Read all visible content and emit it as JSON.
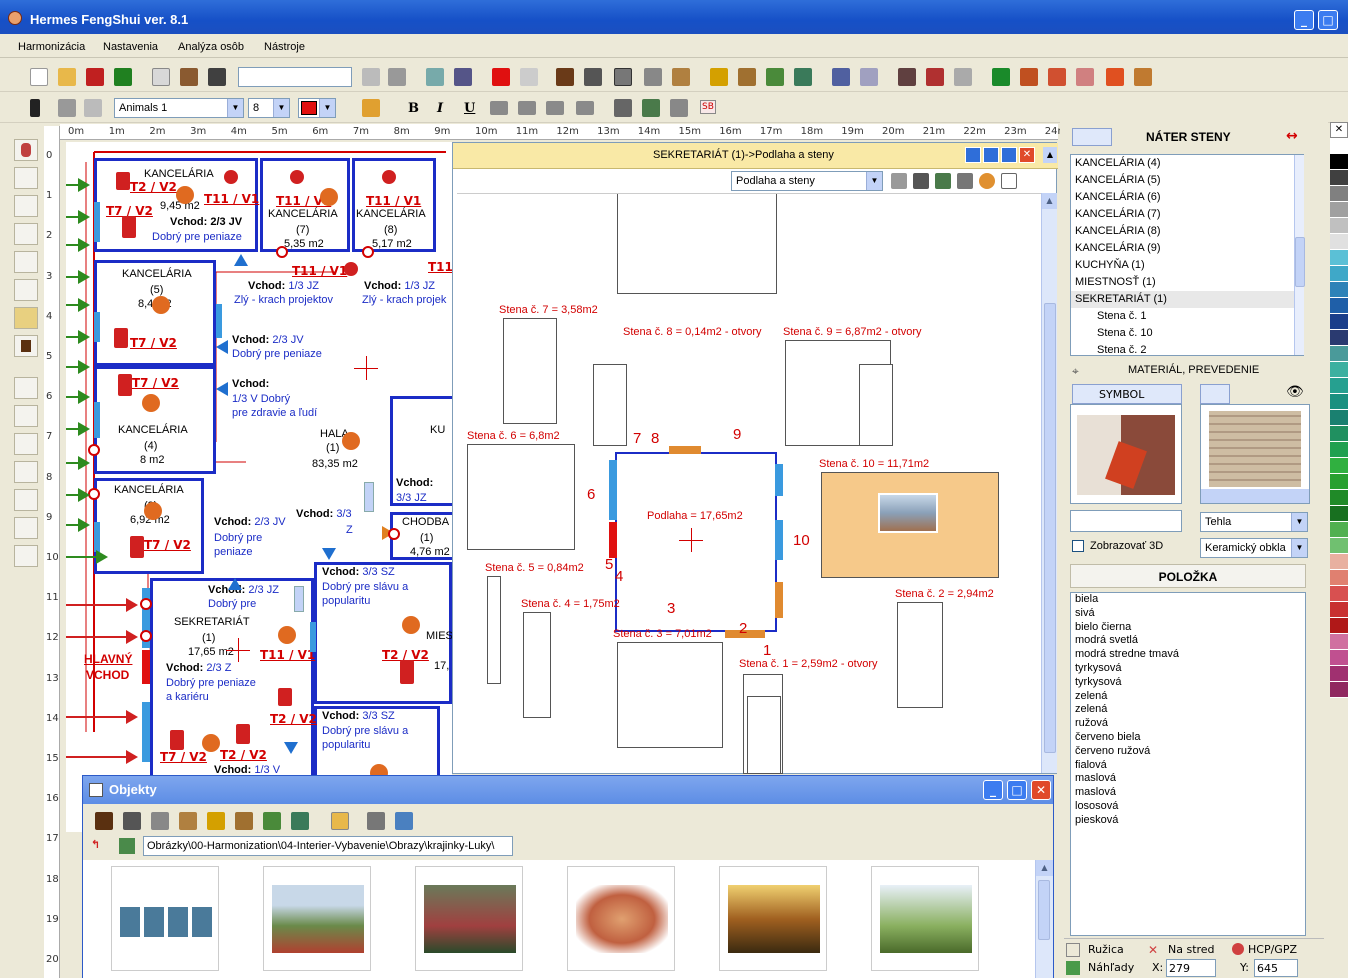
{
  "window": {
    "title": "Hermes FengShui ver. 8.1"
  },
  "menu": [
    "Harmonizácia",
    "Nastavenia",
    "Analýza osôb",
    "Nástroje"
  ],
  "toolbar2": {
    "font": "Animals 1",
    "size": "8",
    "bold": "B",
    "italic": "I",
    "underline": "U",
    "sb": "SB"
  },
  "ruler_h": [
    "0m",
    "1m",
    "2m",
    "3m",
    "4m",
    "5m",
    "6m",
    "7m",
    "8m",
    "9m",
    "10m",
    "11m",
    "12m",
    "13m",
    "14m",
    "15m",
    "16m",
    "17m",
    "18m",
    "19m",
    "20m",
    "21m",
    "22m",
    "23m",
    "24m"
  ],
  "ruler_v": [
    "0",
    "1",
    "2",
    "3",
    "4",
    "5",
    "6",
    "7",
    "8",
    "9",
    "10",
    "11",
    "12",
    "13",
    "14",
    "15",
    "16",
    "17",
    "18",
    "19",
    "20"
  ],
  "plan": {
    "rooms": [
      {
        "name": "KANCELÁRIA",
        "line2": "9,45 m2",
        "vchod": "Vchod: 2/3 JV",
        "note": "Dobrý pre peniaze"
      },
      {
        "name": "KANCELÁRIA",
        "line2": "(7)",
        "line3": "5,35 m2"
      },
      {
        "name": "KANCELÁRIA",
        "line2": "(8)",
        "line3": "5,17 m2"
      },
      {
        "name": "KANCELÁRIA",
        "line2": "(5)",
        "line3": "8,4 m2"
      },
      {
        "name": "KANCELÁRIA",
        "line2": "(4)",
        "line3": "8 m2"
      },
      {
        "name": "KANCELÁRIA",
        "line2": "(3)",
        "line3": "6,92 m2"
      },
      {
        "name": "SEKRETARIÁT",
        "line2": "(1)",
        "line3": "17,65 m2"
      },
      {
        "name": "HALA",
        "line2": "(1)",
        "line3": "83,35 m2"
      },
      {
        "name": "KU"
      },
      {
        "name": "CHODBA",
        "line2": "(1)",
        "line3": "4,76 m2"
      },
      {
        "name": "MIES"
      }
    ],
    "tags": [
      "T2 / V2",
      "T11 / V1",
      "T7 / V2",
      "T11 / V1",
      "T11 / V1",
      "T11 / V1",
      "T11",
      "T7 / V2",
      "T7 / V2",
      "T7 / V2",
      "T2 / V2",
      "T11 / V1",
      "T2 / V2",
      "T7 / V2",
      "T2 / V2"
    ],
    "entries": [
      {
        "title": "Vchod:",
        "text": "1/3 JZ",
        "note": "Zlý - krach projektov"
      },
      {
        "title": "Vchod:",
        "text": "1/3 JZ",
        "note": "Zlý - krach projek"
      },
      {
        "title": "Vchod:",
        "text": "2/3 JV",
        "note": "Dobrý pre peniaze"
      },
      {
        "title": "Vchod:",
        "text": "1/3 V Dobrý",
        "note": "pre zdravie a ľudí"
      },
      {
        "title": "Vchod:",
        "text": "3/3 JZ"
      },
      {
        "title": "Vchod:",
        "text": "2/3 JV",
        "note": "Dobrý pre",
        "note2": "peniaze"
      },
      {
        "title": "Vchod:",
        "text": "3/3",
        "note": "Z"
      },
      {
        "title": "Vchod:",
        "text": "2/3 JZ",
        "note": "Dobrý pre"
      },
      {
        "title": "Vchod:",
        "text": "3/3 SZ",
        "note": "Dobrý pre slávu a",
        "note2": "popularitu"
      },
      {
        "title": "Vchod:",
        "text": "2/3 Z",
        "note": "Dobrý pre peniaze",
        "note2": "a kariéru"
      },
      {
        "title": "Vchod:",
        "text": "3/3 SZ",
        "note": "Dobrý pre slávu a",
        "note2": "popularitu"
      },
      {
        "title": "Vchod:",
        "text": "1/3 V"
      }
    ],
    "main_entrance": [
      "HLAVNÝ",
      "VCHOD"
    ],
    "num17": "17,"
  },
  "subwindow": {
    "title": "SEKRETARIÁT (1)->Podlaha a steny",
    "select": "Podlaha a steny",
    "labels": {
      "s7": "Stena č. 7 = 3,58m2",
      "s8": "Stena č. 8 = 0,14m2 - otvory",
      "s9": "Stena č. 9 = 6,87m2 - otvory",
      "s6": "Stena č. 6 = 6,8m2",
      "s10": "Stena č. 10 = 11,71m2",
      "floor": "Podlaha = 17,65m2",
      "s5": "Stena č. 5 = 0,84m2",
      "s4": "Stena č. 4 = 1,75m2",
      "s3": "Stena č. 3 = 7,01m2",
      "s2": "Stena č. 2 = 2,94m2",
      "s1": "Stena č. 1 = 2,59m2 - otvory"
    },
    "nums": {
      "n7": "7",
      "n8": "8",
      "n9": "9",
      "n6": "6",
      "n10": "10",
      "n5": "5",
      "n4": "4",
      "n3": "3",
      "n2": "2",
      "n1": "1"
    }
  },
  "right": {
    "header": "NÁTER STENY",
    "tree": [
      "KANCELÁRIA (4)",
      "KANCELÁRIA (5)",
      "KANCELÁRIA (6)",
      "KANCELÁRIA (7)",
      "KANCELÁRIA (8)",
      "KANCELÁRIA (9)",
      "KUCHYŇA (1)",
      "MIESTNOSŤ (1)",
      "SEKRETARIÁT (1)",
      "Stena č. 1",
      "Stena č. 10",
      "Stena č. 2"
    ],
    "material": "MATERIÁL, PREVEDENIE",
    "symbol": "SYMBOL",
    "select1": "Tehla",
    "checkbox": "Zobrazovať 3D",
    "select2": "Keramický obkla",
    "item_header": "POLOŽKA",
    "items": [
      "biela",
      "sivá",
      "bielo čierna",
      "modrá svetlá",
      "modrá stredne tmavá",
      "tyrkysová",
      "tyrkysová",
      "zelená",
      "zelená",
      "ružová",
      "červeno biela",
      "červeno ružová",
      "fialová",
      "maslová",
      "maslová",
      "lososová",
      "piesková"
    ],
    "status": {
      "ruzica": "Ružica",
      "nastred": "Na stred",
      "hcp": "HCP/GPZ",
      "nahrady": "Náhľady",
      "x_label": "X:",
      "x": "279",
      "y_label": "Y:",
      "y": "645"
    }
  },
  "objekty": {
    "title": "Objekty",
    "path": "Obrázky\\00-Harmonization\\04-Interier-Vybavenie\\Obrazy\\krajinky-Luky\\"
  },
  "palette": [
    "#ffffff",
    "#000000",
    "#404040",
    "#808080",
    "#a0a0a0",
    "#c0c0c0",
    "#e0e0e0",
    "#5bc0d6",
    "#3fa8c8",
    "#2d82b8",
    "#1f5fa8",
    "#1a3e8a",
    "#2a3a70",
    "#4a9a9a",
    "#3cb0a0",
    "#26a090",
    "#1a9080",
    "#1a8070",
    "#209060",
    "#20a050",
    "#30b040",
    "#28a030",
    "#208a28",
    "#187020",
    "#50b050",
    "#70c070",
    "#e8b0a0",
    "#e08070",
    "#d85050",
    "#c83030",
    "#b01818",
    "#d070a0",
    "#c05090",
    "#a03070",
    "#902860"
  ]
}
